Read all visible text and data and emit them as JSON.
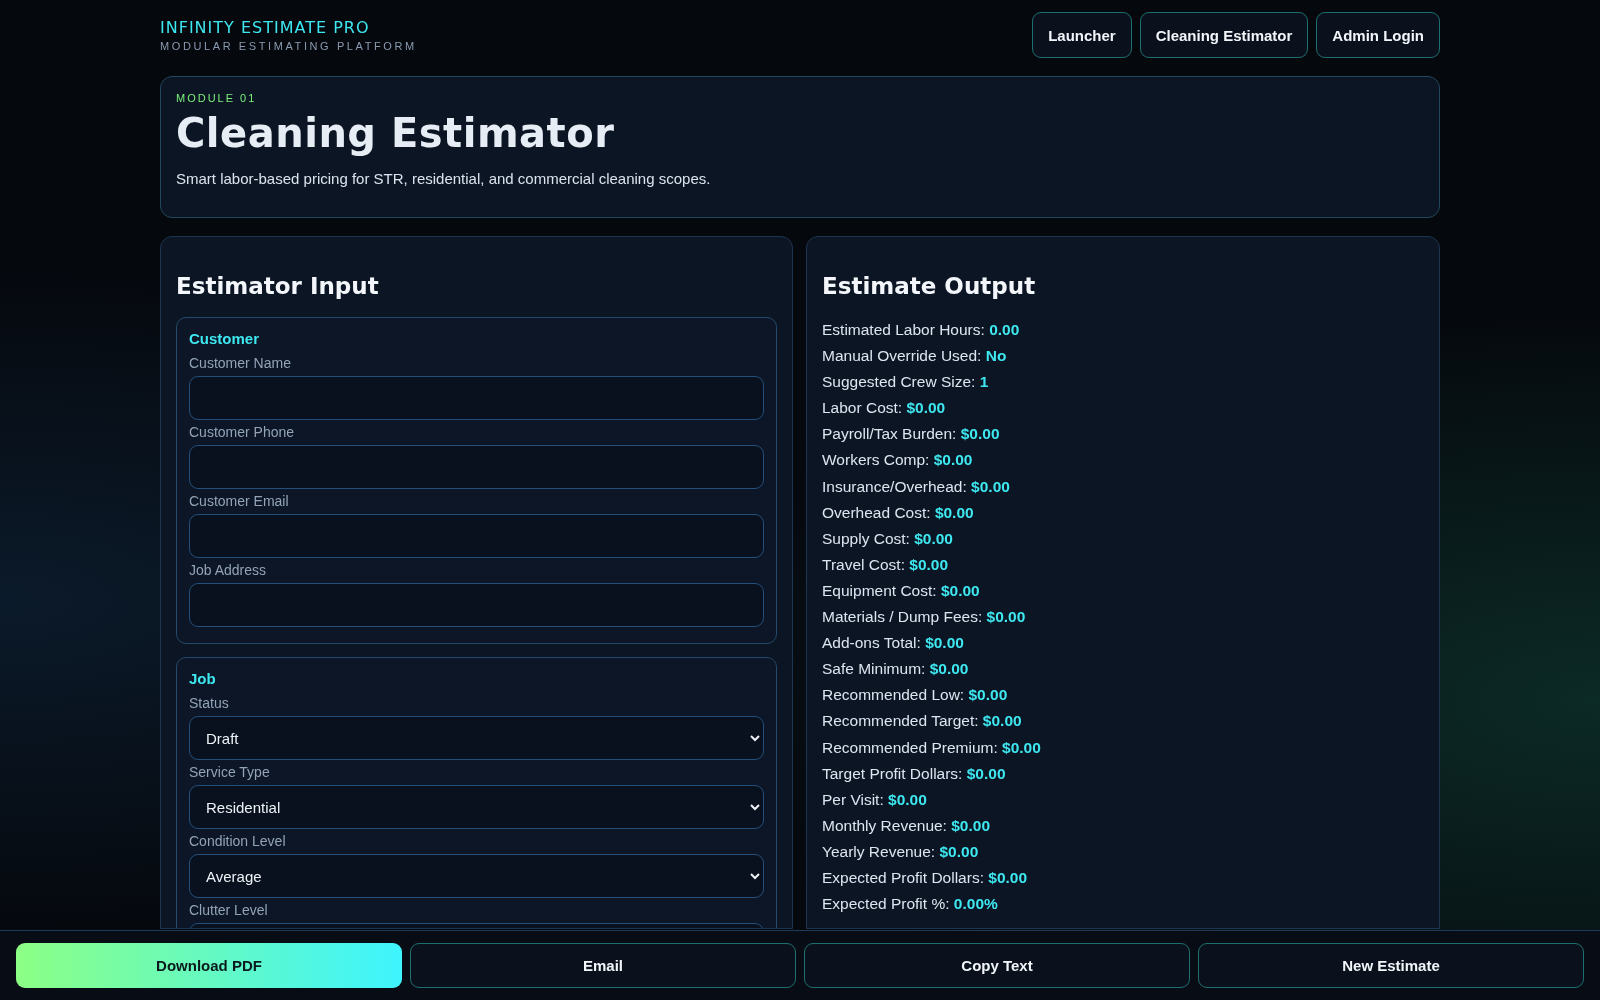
{
  "brand": {
    "title": "INFINITY ESTIMATE PRO",
    "subtitle": "MODULAR ESTIMATING PLATFORM"
  },
  "nav": [
    "Launcher",
    "Cleaning Estimator",
    "Admin Login"
  ],
  "hero": {
    "eyebrow": "MODULE 01",
    "title": "Cleaning Estimator",
    "description": "Smart labor-based pricing for STR, residential, and commercial cleaning scopes."
  },
  "input_panel": {
    "title": "Estimator Input",
    "sections": [
      {
        "title": "Customer",
        "fields": [
          {
            "kind": "text",
            "label": "Customer Name"
          },
          {
            "kind": "text",
            "label": "Customer Phone"
          },
          {
            "kind": "text",
            "label": "Customer Email"
          },
          {
            "kind": "text",
            "label": "Job Address"
          }
        ]
      },
      {
        "title": "Job",
        "fields": [
          {
            "kind": "select",
            "label": "Status",
            "value": "Draft"
          },
          {
            "kind": "select",
            "label": "Service Type",
            "value": "Residential"
          },
          {
            "kind": "select",
            "label": "Condition Level",
            "value": "Average"
          },
          {
            "kind": "select",
            "label": "Clutter Level"
          }
        ]
      }
    ]
  },
  "output_panel": {
    "title": "Estimate Output",
    "rows": [
      {
        "label": "Estimated Labor Hours:",
        "value": "0.00"
      },
      {
        "label": "Manual Override Used:",
        "value": "No"
      },
      {
        "label": "Suggested Crew Size:",
        "value": "1"
      },
      {
        "label": "Labor Cost:",
        "value": "$0.00"
      },
      {
        "label": "Payroll/Tax Burden:",
        "value": "$0.00"
      },
      {
        "label": "Workers Comp:",
        "value": "$0.00"
      },
      {
        "label": "Insurance/Overhead:",
        "value": "$0.00"
      },
      {
        "label": "Overhead Cost:",
        "value": "$0.00"
      },
      {
        "label": "Supply Cost:",
        "value": "$0.00"
      },
      {
        "label": "Travel Cost:",
        "value": "$0.00"
      },
      {
        "label": "Equipment Cost:",
        "value": "$0.00"
      },
      {
        "label": "Materials / Dump Fees:",
        "value": "$0.00"
      },
      {
        "label": "Add-ons Total:",
        "value": "$0.00"
      },
      {
        "label": "Safe Minimum:",
        "value": "$0.00"
      },
      {
        "label": "Recommended Low:",
        "value": "$0.00"
      },
      {
        "label": "Recommended Target:",
        "value": "$0.00"
      },
      {
        "label": "Recommended Premium:",
        "value": "$0.00"
      },
      {
        "label": "Target Profit Dollars:",
        "value": "$0.00"
      },
      {
        "label": "Per Visit:",
        "value": "$0.00"
      },
      {
        "label": "Monthly Revenue:",
        "value": "$0.00"
      },
      {
        "label": "Yearly Revenue:",
        "value": "$0.00"
      },
      {
        "label": "Expected Profit Dollars:",
        "value": "$0.00"
      },
      {
        "label": "Expected Profit %:",
        "value": "0.00%"
      }
    ]
  },
  "actions": [
    {
      "kind": "primary",
      "label": "Download PDF"
    },
    {
      "kind": "secondary",
      "label": "Email"
    },
    {
      "kind": "secondary",
      "label": "Copy Text"
    },
    {
      "kind": "secondary",
      "label": "New Estimate"
    }
  ]
}
